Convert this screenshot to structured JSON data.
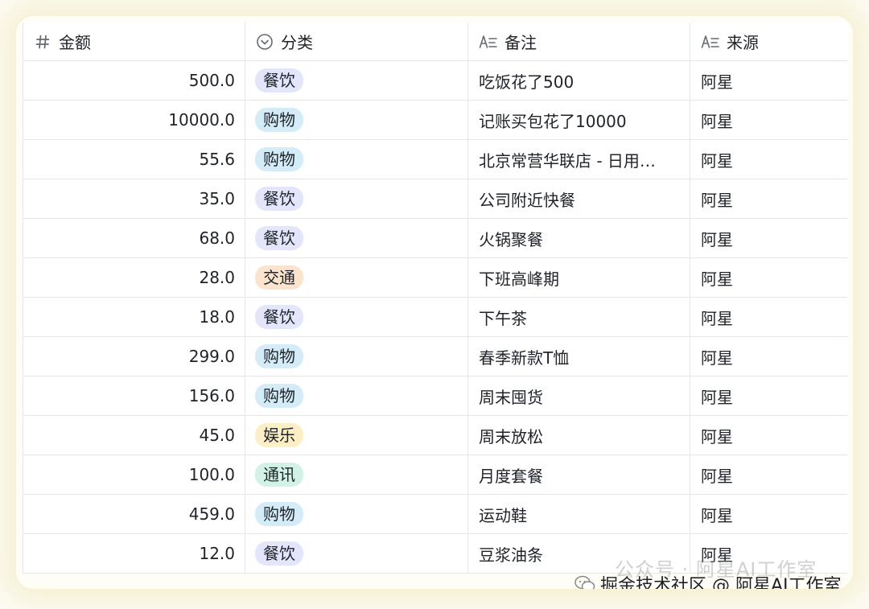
{
  "columns": [
    {
      "label": "金额",
      "icon": "number-icon"
    },
    {
      "label": "分类",
      "icon": "single-select-icon"
    },
    {
      "label": "备注",
      "icon": "text-field-icon"
    },
    {
      "label": "来源",
      "icon": "text-field-icon"
    }
  ],
  "tag_colors": {
    "餐饮": "#e3e6fb",
    "购物": "#d4ecf8",
    "交通": "#fbe3cd",
    "娱乐": "#fcefc6",
    "通讯": "#d3f1e5"
  },
  "rows": [
    {
      "amount": "500.0",
      "category": "餐饮",
      "note": "吃饭花了500",
      "source": "阿星"
    },
    {
      "amount": "10000.0",
      "category": "购物",
      "note": "记账买包花了10000",
      "source": "阿星"
    },
    {
      "amount": "55.6",
      "category": "购物",
      "note": "北京常营华联店 - 日用…",
      "source": "阿星"
    },
    {
      "amount": "35.0",
      "category": "餐饮",
      "note": "公司附近快餐",
      "source": "阿星"
    },
    {
      "amount": "68.0",
      "category": "餐饮",
      "note": "火锅聚餐",
      "source": "阿星"
    },
    {
      "amount": "28.0",
      "category": "交通",
      "note": "下班高峰期",
      "source": "阿星"
    },
    {
      "amount": "18.0",
      "category": "餐饮",
      "note": "下午茶",
      "source": "阿星"
    },
    {
      "amount": "299.0",
      "category": "购物",
      "note": "春季新款T恤",
      "source": "阿星"
    },
    {
      "amount": "156.0",
      "category": "购物",
      "note": "周末囤货",
      "source": "阿星"
    },
    {
      "amount": "45.0",
      "category": "娱乐",
      "note": "周末放松",
      "source": "阿星"
    },
    {
      "amount": "100.0",
      "category": "通讯",
      "note": "月度套餐",
      "source": "阿星"
    },
    {
      "amount": "459.0",
      "category": "购物",
      "note": "运动鞋",
      "source": "阿星"
    },
    {
      "amount": "12.0",
      "category": "餐饮",
      "note": "豆浆油条",
      "source": "阿星"
    }
  ],
  "watermark": {
    "text": "掘金技术社区 @ 阿星AI工作室",
    "ghost_text": "公众号 · 阿星AI工作室"
  }
}
